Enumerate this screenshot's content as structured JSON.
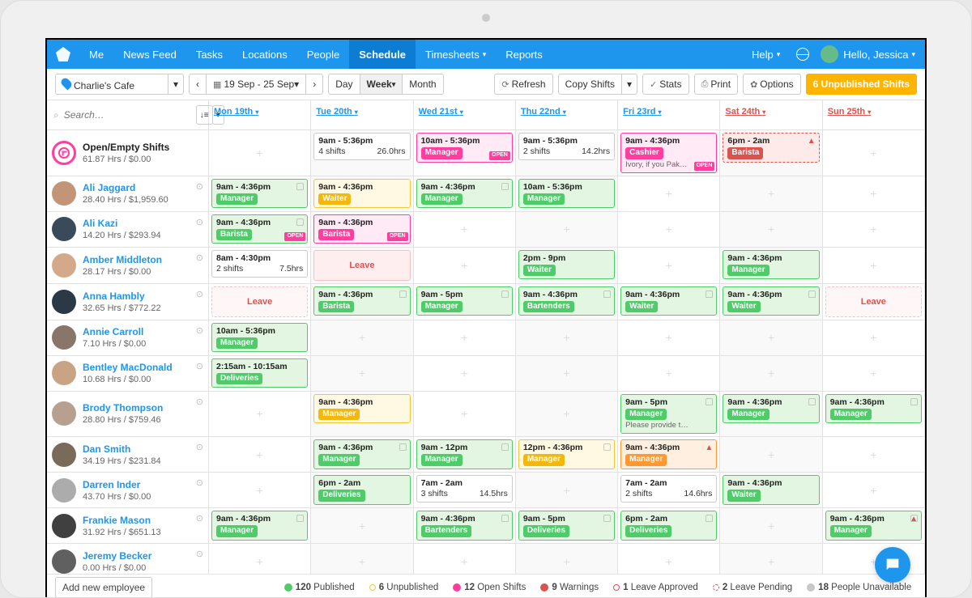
{
  "nav": {
    "items": [
      "Me",
      "News Feed",
      "Tasks",
      "Locations",
      "People",
      "Schedule",
      "Timesheets",
      "Reports"
    ],
    "active": "Schedule",
    "help": "Help",
    "greeting": "Hello, Jessica"
  },
  "toolbar": {
    "location": "Charlie's Cafe",
    "prev": "‹",
    "next": "›",
    "range": "19 Sep - 25 Sep",
    "views": [
      "Day",
      "Week",
      "Month"
    ],
    "active_view": "Week",
    "refresh": "Refresh",
    "copy": "Copy Shifts",
    "stats": "Stats",
    "print": "Print",
    "options": "Options",
    "unpublished": "6 Unpublished Shifts"
  },
  "search_placeholder": "Search…",
  "days": [
    {
      "label": "Mon 19th",
      "weekend": false
    },
    {
      "label": "Tue 20th",
      "weekend": false
    },
    {
      "label": "Wed 21st",
      "weekend": false
    },
    {
      "label": "Thu 22nd",
      "weekend": false
    },
    {
      "label": "Fri 23rd",
      "weekend": false
    },
    {
      "label": "Sat 24th",
      "weekend": true
    },
    {
      "label": "Sun 25th",
      "weekend": true
    }
  ],
  "rows": [
    {
      "name": "Open/Empty Shifts",
      "meta": "61.87 Hrs / $0.00",
      "open": true,
      "cells": [
        {
          "type": "empty"
        },
        {
          "type": "summary",
          "time": "9am - 5:36pm",
          "l2": "4 shifts",
          "r2": "26.0hrs",
          "style": "white"
        },
        {
          "type": "shift",
          "time": "10am - 5:36pm",
          "tag": "Manager",
          "style": "pink",
          "tagc": "tag-pink",
          "open_badge": true
        },
        {
          "type": "summary",
          "time": "9am - 5:36pm",
          "l2": "2 shifts",
          "r2": "14.2hrs",
          "style": "white"
        },
        {
          "type": "shift",
          "time": "9am - 4:36pm",
          "tag": "Cashier",
          "style": "pink",
          "tagc": "tag-pink",
          "sub": "Ivory, if you Pak…",
          "open_badge": true
        },
        {
          "type": "shift",
          "time": "6pm - 2am",
          "tag": "Barista",
          "style": "red-dash",
          "tagc": "tag-red",
          "warn": true
        },
        {
          "type": "empty"
        }
      ]
    },
    {
      "name": "Ali Jaggard",
      "meta": "28.40 Hrs / $1,959.60",
      "av": "av-1",
      "cells": [
        {
          "type": "shift",
          "time": "9am - 4:36pm",
          "tag": "Manager",
          "style": "green",
          "tagc": "tag-green",
          "lock": true
        },
        {
          "type": "shift",
          "time": "9am - 4:36pm",
          "tag": "Waiter",
          "style": "yellow",
          "tagc": "tag-yellow"
        },
        {
          "type": "shift",
          "time": "9am - 4:36pm",
          "tag": "Manager",
          "style": "green",
          "tagc": "tag-green",
          "lock": true
        },
        {
          "type": "shift",
          "time": "10am - 5:36pm",
          "tag": "Manager",
          "style": "green",
          "tagc": "tag-green"
        },
        {
          "type": "empty"
        },
        {
          "type": "empty"
        },
        {
          "type": "empty"
        }
      ]
    },
    {
      "name": "Ali Kazi",
      "meta": "14.20 Hrs / $293.94",
      "av": "av-2",
      "cells": [
        {
          "type": "shift",
          "time": "9am - 4:36pm",
          "tag": "Barista",
          "style": "green",
          "tagc": "tag-green",
          "lock": true,
          "open_badge": true
        },
        {
          "type": "shift",
          "time": "9am - 4:36pm",
          "tag": "Barista",
          "style": "pink",
          "tagc": "tag-pink",
          "open_badge": true
        },
        {
          "type": "empty"
        },
        {
          "type": "empty"
        },
        {
          "type": "empty"
        },
        {
          "type": "empty"
        },
        {
          "type": "empty"
        }
      ]
    },
    {
      "name": "Amber Middleton",
      "meta": "28.17 Hrs / $0.00",
      "av": "av-3",
      "cells": [
        {
          "type": "summary",
          "time": "8am - 4:30pm",
          "l2": "2 shifts",
          "r2": "7.5hrs",
          "style": "white"
        },
        {
          "type": "leave"
        },
        {
          "type": "empty"
        },
        {
          "type": "shift",
          "time": "2pm - 9pm",
          "tag": "Waiter",
          "style": "green",
          "tagc": "tag-green"
        },
        {
          "type": "empty"
        },
        {
          "type": "shift",
          "time": "9am - 4:36pm",
          "tag": "Manager",
          "style": "green",
          "tagc": "tag-green"
        },
        {
          "type": "empty"
        }
      ]
    },
    {
      "name": "Anna Hambly",
      "meta": "32.65 Hrs / $772.22",
      "av": "av-4",
      "cells": [
        {
          "type": "leave",
          "dash": true
        },
        {
          "type": "shift",
          "time": "9am - 4:36pm",
          "tag": "Barista",
          "style": "green",
          "tagc": "tag-green",
          "lock": true
        },
        {
          "type": "shift",
          "time": "9am - 5pm",
          "tag": "Manager",
          "style": "green",
          "tagc": "tag-green",
          "lock": true
        },
        {
          "type": "shift",
          "time": "9am - 4:36pm",
          "tag": "Bartenders",
          "style": "green",
          "tagc": "tag-green",
          "lock": true
        },
        {
          "type": "shift",
          "time": "9am - 4:36pm",
          "tag": "Waiter",
          "style": "green",
          "tagc": "tag-green",
          "lock": true
        },
        {
          "type": "shift",
          "time": "9am - 4:36pm",
          "tag": "Waiter",
          "style": "green",
          "tagc": "tag-green",
          "lock": true
        },
        {
          "type": "leave",
          "dash": true
        }
      ]
    },
    {
      "name": "Annie Carroll",
      "meta": "7.10 Hrs / $0.00",
      "av": "av-5",
      "cells": [
        {
          "type": "shift",
          "time": "10am - 5:36pm",
          "tag": "Manager",
          "style": "green",
          "tagc": "tag-green"
        },
        {
          "type": "empty"
        },
        {
          "type": "empty"
        },
        {
          "type": "empty"
        },
        {
          "type": "empty"
        },
        {
          "type": "empty"
        },
        {
          "type": "empty"
        }
      ]
    },
    {
      "name": "Bentley MacDonald",
      "meta": "10.68 Hrs / $0.00",
      "av": "av-6",
      "cells": [
        {
          "type": "shift",
          "time": "2:15am - 10:15am",
          "tag": "Deliveries",
          "style": "green",
          "tagc": "tag-green"
        },
        {
          "type": "empty"
        },
        {
          "type": "empty"
        },
        {
          "type": "empty"
        },
        {
          "type": "empty"
        },
        {
          "type": "empty"
        },
        {
          "type": "empty"
        }
      ]
    },
    {
      "name": "Brody Thompson",
      "meta": "28.80 Hrs / $759.46",
      "av": "av-7",
      "cells": [
        {
          "type": "empty"
        },
        {
          "type": "shift",
          "time": "9am - 4:36pm",
          "tag": "Manager",
          "style": "yellow",
          "tagc": "tag-yellow"
        },
        {
          "type": "empty"
        },
        {
          "type": "empty"
        },
        {
          "type": "shift",
          "time": "9am - 5pm",
          "tag": "Manager",
          "style": "green",
          "tagc": "tag-green",
          "lock": true,
          "sub": "Please provide t…"
        },
        {
          "type": "shift",
          "time": "9am - 4:36pm",
          "tag": "Manager",
          "style": "green",
          "tagc": "tag-green",
          "lock": true
        },
        {
          "type": "shift",
          "time": "9am - 4:36pm",
          "tag": "Manager",
          "style": "green",
          "tagc": "tag-green",
          "lock": true
        }
      ]
    },
    {
      "name": "Dan Smith",
      "meta": "34.19 Hrs / $231.84",
      "av": "av-8",
      "cells": [
        {
          "type": "empty"
        },
        {
          "type": "shift",
          "time": "9am - 4:36pm",
          "tag": "Manager",
          "style": "green",
          "tagc": "tag-green",
          "lock": true
        },
        {
          "type": "shift",
          "time": "9am - 12pm",
          "tag": "Manager",
          "style": "green",
          "tagc": "tag-green",
          "lock": true
        },
        {
          "type": "shift",
          "time": "12pm - 4:36pm",
          "tag": "Manager",
          "style": "yellow",
          "tagc": "tag-yellow",
          "lock": true
        },
        {
          "type": "shift",
          "time": "9am - 4:36pm",
          "tag": "Manager",
          "style": "orange",
          "tagc": "tag-orange",
          "warn": true
        },
        {
          "type": "empty"
        },
        {
          "type": "empty"
        }
      ]
    },
    {
      "name": "Darren Inder",
      "meta": "43.70 Hrs / $0.00",
      "av": "av-9",
      "cells": [
        {
          "type": "empty"
        },
        {
          "type": "shift",
          "time": "6pm - 2am",
          "tag": "Deliveries",
          "style": "green",
          "tagc": "tag-green"
        },
        {
          "type": "summary",
          "time": "7am - 2am",
          "l2": "3 shifts",
          "r2": "14.5hrs",
          "style": "white"
        },
        {
          "type": "empty"
        },
        {
          "type": "summary",
          "time": "7am - 2am",
          "l2": "2 shifts",
          "r2": "14.6hrs",
          "style": "white"
        },
        {
          "type": "shift",
          "time": "9am - 4:36pm",
          "tag": "Waiter",
          "style": "green",
          "tagc": "tag-green"
        },
        {
          "type": "empty"
        }
      ]
    },
    {
      "name": "Frankie Mason",
      "meta": "31.92 Hrs / $651.13",
      "av": "av-10",
      "cells": [
        {
          "type": "shift",
          "time": "9am - 4:36pm",
          "tag": "Manager",
          "style": "green",
          "tagc": "tag-green",
          "lock": true
        },
        {
          "type": "empty"
        },
        {
          "type": "shift",
          "time": "9am - 4:36pm",
          "tag": "Bartenders",
          "style": "green",
          "tagc": "tag-green",
          "lock": true
        },
        {
          "type": "shift",
          "time": "9am - 5pm",
          "tag": "Deliveries",
          "style": "green",
          "tagc": "tag-green",
          "lock": true
        },
        {
          "type": "shift",
          "time": "6pm - 2am",
          "tag": "Deliveries",
          "style": "green",
          "tagc": "tag-green",
          "lock": true
        },
        {
          "type": "empty"
        },
        {
          "type": "shift",
          "time": "9am - 4:36pm",
          "tag": "Manager",
          "style": "green",
          "tagc": "tag-green",
          "lock": true,
          "warn": true
        }
      ]
    },
    {
      "name": "Jeremy Becker",
      "meta": "0.00 Hrs / $0.00",
      "av": "av-11",
      "cells": [
        {
          "type": "empty"
        },
        {
          "type": "empty"
        },
        {
          "type": "empty"
        },
        {
          "type": "empty"
        },
        {
          "type": "empty"
        },
        {
          "type": "empty"
        },
        {
          "type": "empty"
        }
      ]
    }
  ],
  "footer": {
    "add": "Add new employee",
    "legend": [
      {
        "color": "#4fcb6a",
        "count": "120",
        "label": "Published",
        "hollow": false
      },
      {
        "color": "#f2c935",
        "count": "6",
        "label": "Unpublished",
        "hollow": true
      },
      {
        "color": "#ff3e9e",
        "count": "12",
        "label": "Open Shifts",
        "hollow": false
      },
      {
        "color": "#d9534f",
        "count": "9",
        "label": "Warnings",
        "hollow": false
      },
      {
        "color": "#d9534f",
        "count": "1",
        "label": "Leave Approved",
        "hollow": true
      },
      {
        "color": "#d9534f",
        "count": "2",
        "label": "Leave Pending",
        "dash": true
      },
      {
        "color": "#c8c8c8",
        "count": "18",
        "label": "People Unavailable",
        "hollow": false
      }
    ]
  },
  "leave_text": "Leave"
}
